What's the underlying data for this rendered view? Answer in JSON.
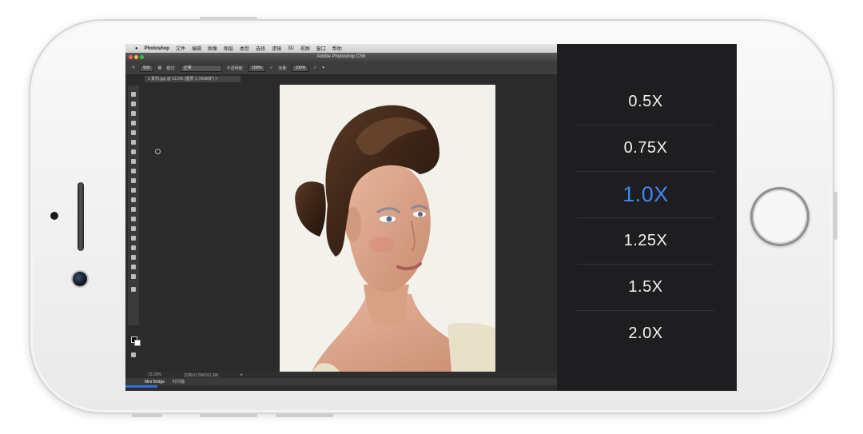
{
  "photoshop": {
    "menubar": {
      "app_name": "Photoshop",
      "items": [
        "文件",
        "编辑",
        "图像",
        "图层",
        "类型",
        "选择",
        "滤镜",
        "3D",
        "视图",
        "窗口",
        "帮助"
      ]
    },
    "window_title": "Adobe Photoshop CS6",
    "options_bar": {
      "size_value": "500",
      "mode_label": "模式:",
      "mode_value": "正常",
      "opacity_label": "不透明度:",
      "opacity_value": "100%",
      "flow_label": "流量:",
      "flow_value": "100%"
    },
    "doc_tab": "1 素材.jpg @ 13.3% (图层 1, RGB/8*) ×",
    "status": {
      "zoom": "13.33%",
      "doc_size": "文档:61.5M/161.6M"
    },
    "panel_tabs": [
      "Mini Bridge",
      "时间轴"
    ]
  },
  "speed_picker": {
    "items": [
      {
        "label": "0.5X",
        "selected": false
      },
      {
        "label": "0.75X",
        "selected": false
      },
      {
        "label": "1.0X",
        "selected": true
      },
      {
        "label": "1.25X",
        "selected": false
      },
      {
        "label": "1.5X",
        "selected": false
      },
      {
        "label": "2.0X",
        "selected": false
      }
    ],
    "selected_color": "#3f86f0",
    "text_color": "#f2f2f2"
  }
}
